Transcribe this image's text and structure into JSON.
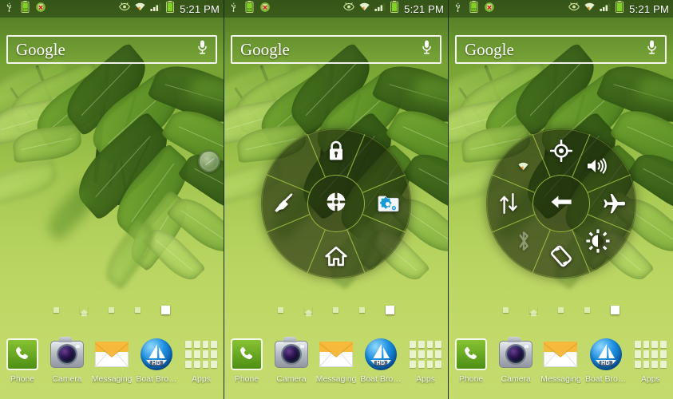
{
  "device": {
    "status_bar": {
      "left_icons": [
        "usb-icon",
        "battery-charging-icon",
        "android-error-icon"
      ],
      "right_icons": [
        "eye-icon",
        "wifi-icon",
        "signal-bars-icon",
        "battery-icon"
      ],
      "time": "5:21 PM"
    },
    "search": {
      "brand_label": "Google",
      "voice_icon": "microphone-icon"
    },
    "page_indicator": {
      "count": 5,
      "home_index": 1,
      "active_index": 4
    },
    "dock": {
      "items": [
        {
          "label": "Phone",
          "icon": "phone-icon"
        },
        {
          "label": "Camera",
          "icon": "camera-icon"
        },
        {
          "label": "Messaging",
          "icon": "envelope-icon"
        },
        {
          "label": "Boat Bro…",
          "icon": "boat-browser-icon",
          "badge": "HD"
        },
        {
          "label": "Apps",
          "icon": "apps-grid-icon"
        }
      ]
    }
  },
  "panels": [
    {
      "id": "panel-home",
      "name": "home-screen-idle",
      "floating_trigger": {
        "name": "radial-menu-trigger",
        "visible": true
      },
      "radial_menu": {
        "visible": false
      }
    },
    {
      "id": "panel-radial-main",
      "name": "radial-menu-main",
      "floating_trigger": {
        "name": "radial-menu-trigger",
        "visible": false
      },
      "radial_menu": {
        "visible": true,
        "center": {
          "icon": "crosshair-target-icon",
          "label": ""
        },
        "segments": [
          {
            "angle": -90,
            "icon": "lock-icon",
            "label": "",
            "state": "on"
          },
          {
            "angle": 180,
            "icon": "broom-cleaner-icon",
            "label": "",
            "state": "on"
          },
          {
            "angle": 0,
            "icon": "settings-folder-icon",
            "label": "",
            "state": "on"
          },
          {
            "angle": 90,
            "icon": "home-icon",
            "label": "",
            "state": "on"
          }
        ]
      }
    },
    {
      "id": "panel-radial-toggles",
      "name": "radial-menu-toggles",
      "floating_trigger": {
        "name": "radial-menu-trigger",
        "visible": false
      },
      "radial_menu": {
        "visible": true,
        "center": {
          "icon": "back-arrow-icon",
          "label": ""
        },
        "segments": [
          {
            "angle": -90,
            "icon": "gps-location-icon",
            "label": "",
            "state": "on"
          },
          {
            "angle": -135,
            "icon": "wifi-icon",
            "label": "",
            "state": "on"
          },
          {
            "angle": -45,
            "icon": "volume-speaker-icon",
            "label": "",
            "state": "on"
          },
          {
            "angle": 180,
            "icon": "data-sync-icon",
            "label": "",
            "state": "on"
          },
          {
            "angle": 0,
            "icon": "airplane-mode-icon",
            "label": "",
            "state": "on"
          },
          {
            "angle": 135,
            "icon": "bluetooth-icon",
            "label": "",
            "state": "off"
          },
          {
            "angle": 45,
            "icon": "brightness-icon",
            "label": "",
            "state": "on"
          },
          {
            "angle": 90,
            "icon": "screen-rotation-icon",
            "label": "",
            "state": "on"
          }
        ]
      }
    }
  ],
  "colors": {
    "accent_green": "#a8cd46",
    "wallpaper_top": "#5d8a2a",
    "wallpaper_bottom": "#c9dd78",
    "overlay_dark": "rgba(24,34,10,0.62)",
    "icon_white": "#ffffff",
    "status_text": "#ffffff"
  }
}
